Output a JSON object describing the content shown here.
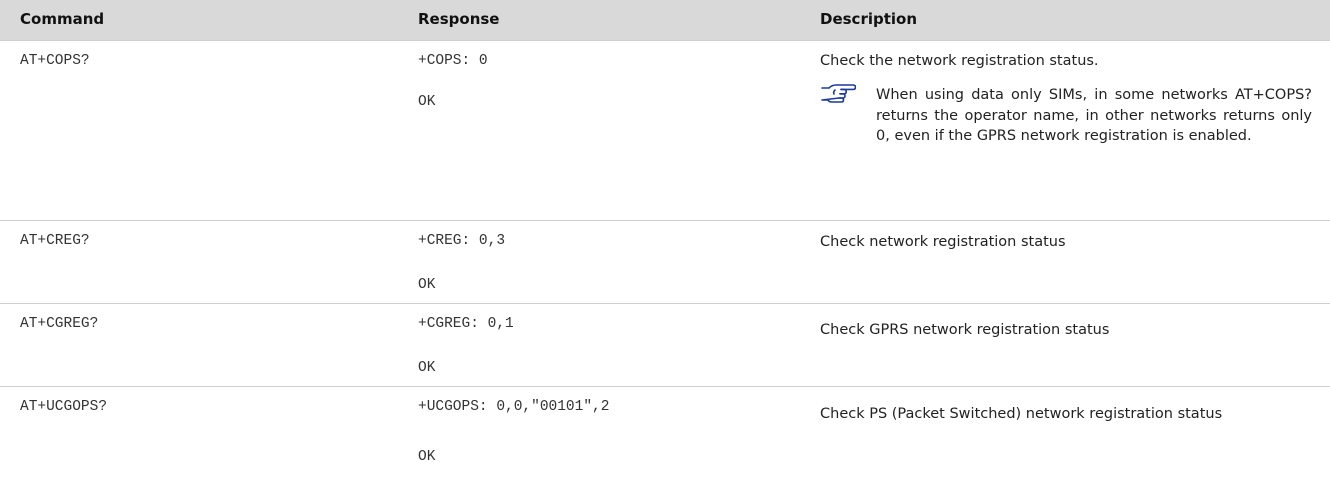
{
  "table": {
    "headers": [
      "Command",
      "Response",
      "Description"
    ],
    "rows": [
      {
        "command": "AT+COPS?",
        "response": "+COPS: 0",
        "ok": "OK",
        "description": "Check the network registration status.",
        "note": "When using data only SIMs, in some networks AT+COPS? returns the operator name, in other networks returns only 0, even if the GPRS network registration is enabled.",
        "note_icon": "pointing-hand-icon"
      },
      {
        "command": "AT+CREG?",
        "response": "+CREG: 0,3",
        "ok": "OK",
        "description": "Check network registration status"
      },
      {
        "command": "AT+CGREG?",
        "response": "+CGREG: 0,1",
        "ok": "OK",
        "description": "Check GPRS network registration status"
      },
      {
        "command": "AT+UCGOPS?",
        "response": "+UCGOPS: 0,0,\"00101\",2",
        "ok": "OK",
        "description": "Check PS (Packet Switched) network registration status"
      }
    ]
  },
  "colors": {
    "header_background": "#d9d9d9",
    "note_icon": "#1a3a9c",
    "row_divider": "#cfcfcf"
  }
}
